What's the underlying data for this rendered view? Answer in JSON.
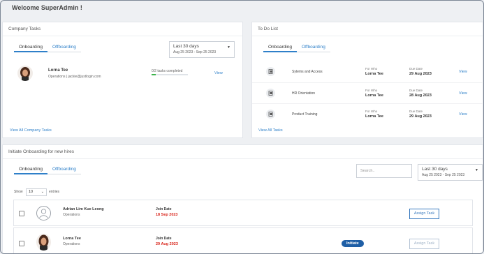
{
  "header": {
    "welcome": "Welcome SuperAdmin !"
  },
  "company_tasks": {
    "title": "Company Tasks",
    "tabs": [
      {
        "label": "Onboarding",
        "active": true
      },
      {
        "label": "Offboarding",
        "active": false
      }
    ],
    "date_range": {
      "label": "Last 30 days",
      "range": "Aug 25 2023 - Sep 25 2023"
    },
    "employee": {
      "name": "Lorna Tee",
      "details": "Operations | jackie@justlogin.com",
      "progress_text": "0/2 tasks completed",
      "progress_fraction": 0.0,
      "view_label": "View"
    },
    "view_all": "View All Company Tasks"
  },
  "todo": {
    "title": "To Do List",
    "tabs": [
      {
        "label": "Onboarding",
        "active": true
      },
      {
        "label": "Offboarding",
        "active": false
      }
    ],
    "for_who_label": "For Who",
    "due_date_label": "Due Date",
    "items": [
      {
        "task": "Sytems and Access",
        "for_who": "Lorna Tee",
        "due": "29 Aug 2023",
        "view": "View"
      },
      {
        "task": "HR Orientation",
        "for_who": "Lorna Tee",
        "due": "28 Aug 2023",
        "view": "View"
      },
      {
        "task": "Product Training",
        "for_who": "Lorna Tee",
        "due": "29 Aug 2023",
        "view": "View"
      }
    ],
    "view_all": "View All Tasks"
  },
  "initiate": {
    "title": "Initiate Onboarding for new hires",
    "tabs": [
      {
        "label": "Onboarding",
        "active": true
      },
      {
        "label": "Offboarding",
        "active": false
      }
    ],
    "search_placeholder": "Search..",
    "date_range": {
      "label": "Last 30 days",
      "range": "Aug 25 2023 - Sep 25 2023"
    },
    "show_label": "Show",
    "entries_value": "10",
    "entries_label": "entries",
    "join_date_label": "Join Date",
    "rows": [
      {
        "name": "Adrian Lim Kue Leong",
        "dept": "Operations",
        "join_date": "18 Sep 2023",
        "badge": "",
        "action": "Assign Task"
      },
      {
        "name": "Lorna Tee",
        "dept": "Operations",
        "join_date": "29 Aug 2023",
        "badge": "Initiate",
        "action": "Assign Task"
      }
    ]
  },
  "colors": {
    "accent": "#2f80c9",
    "due_red": "#d9261c",
    "badge_blue": "#1f5fa6",
    "progress_green": "#3cb44b"
  }
}
